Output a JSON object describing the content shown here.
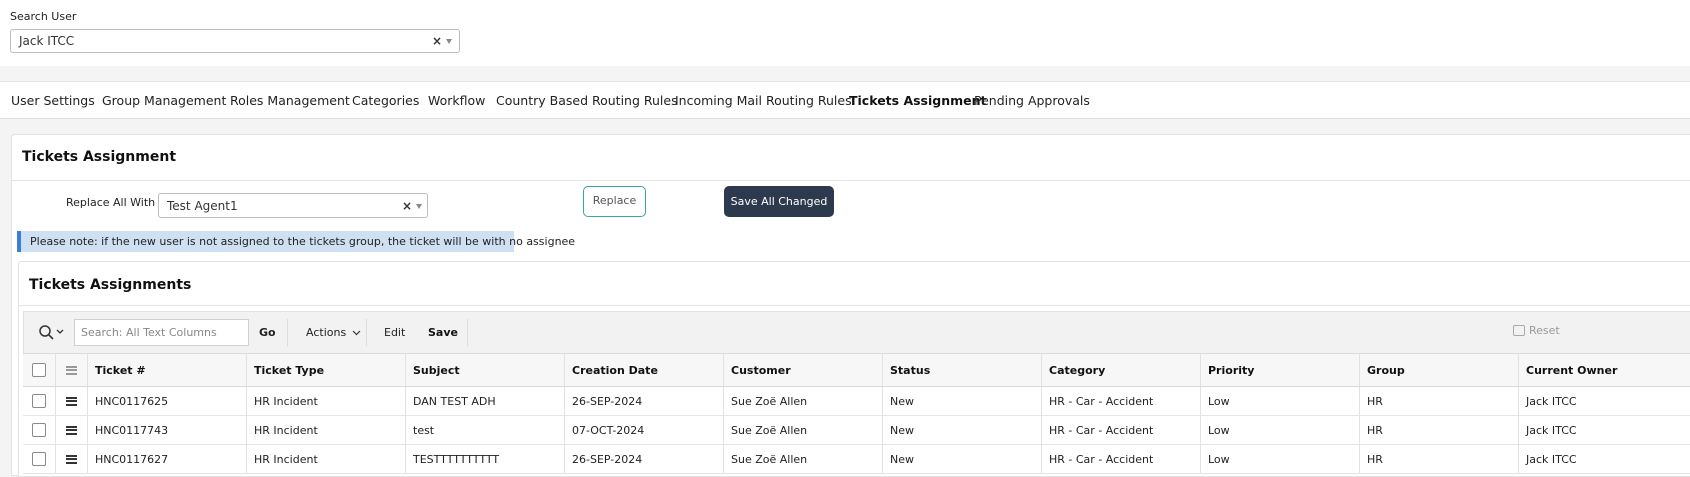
{
  "search_user": {
    "label": "Search User",
    "value": "Jack ITCC",
    "clear_glyph": "×"
  },
  "nav": {
    "items": [
      {
        "label": "User Settings"
      },
      {
        "label": "Group Management"
      },
      {
        "label": "Roles Management"
      },
      {
        "label": "Categories"
      },
      {
        "label": "Workflow"
      },
      {
        "label": "Country Based Routing Rules"
      },
      {
        "label": "Incoming Mail Routing Rules"
      },
      {
        "label": "Tickets Assignment",
        "active": true
      },
      {
        "label": "Pending Approvals"
      }
    ]
  },
  "tickets_assignment": {
    "title": "Tickets Assignment",
    "replace_label": "Replace All With",
    "replace_value": "Test Agent1",
    "clear_glyph": "×",
    "replace_button": "Replace",
    "save_all_button": "Save All Changed",
    "note": "Please note: if the new user is not assigned to the tickets group, the ticket will be with no assignee"
  },
  "region": {
    "title": "Tickets Assignments",
    "toolbar": {
      "search_icon": "search-icon",
      "search_placeholder": "Search: All Text Columns",
      "go_label": "Go",
      "actions_label": "Actions",
      "edit_label": "Edit",
      "save_label": "Save",
      "reset_label": "Reset"
    },
    "columns": [
      "Ticket #",
      "Ticket Type",
      "Subject",
      "Creation Date",
      "Customer",
      "Status",
      "Category",
      "Priority",
      "Group",
      "Current Owner"
    ],
    "rows": [
      [
        "HNC0117625",
        "HR Incident",
        "DAN TEST ADH",
        "26-SEP-2024",
        "Sue Zoë Allen",
        "New",
        "HR - Car - Accident",
        "Low",
        "HR",
        "Jack ITCC"
      ],
      [
        "HNC0117743",
        "HR Incident",
        "test",
        "07-OCT-2024",
        "Sue Zoë Allen",
        "New",
        "HR - Car - Accident",
        "Low",
        "HR",
        "Jack ITCC"
      ],
      [
        "HNC0117627",
        "HR Incident",
        "TESTTTTTTTTTT",
        "26-SEP-2024",
        "Sue Zoë Allen",
        "New",
        "HR - Car - Accident",
        "Low",
        "HR",
        "Jack ITCC"
      ]
    ]
  },
  "colors": {
    "accent_teal": "#3aa6a0",
    "dark_button": "#2d3a4d",
    "note_bg": "#cfe0f2",
    "note_bar": "#3b7ddd"
  }
}
